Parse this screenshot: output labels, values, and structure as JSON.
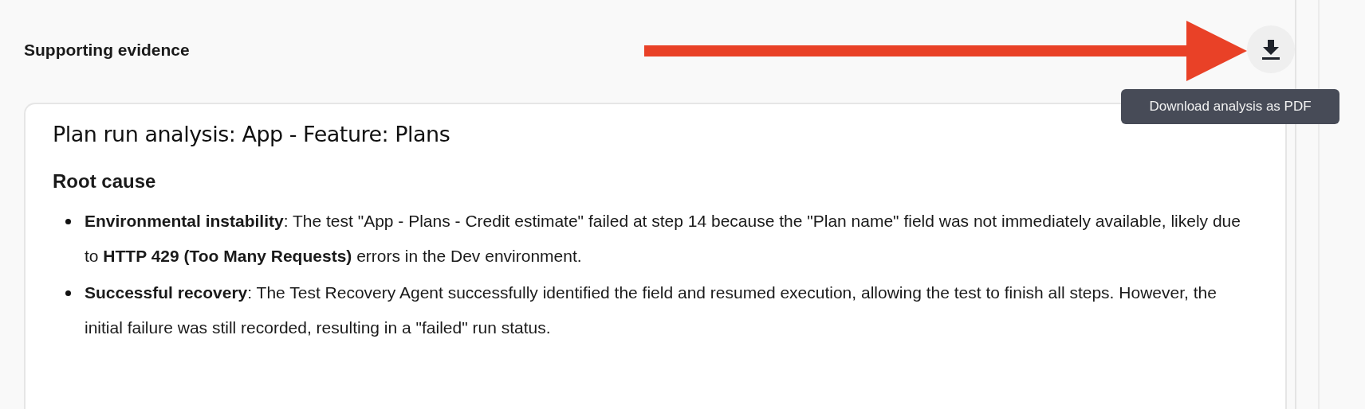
{
  "section": {
    "title": "Supporting evidence"
  },
  "download_button": {
    "tooltip": "Download analysis as PDF"
  },
  "card": {
    "title": "Plan run analysis: App - Feature: Plans",
    "subheading": "Root cause",
    "bullets": [
      {
        "text": "**Environmental instability**: The test \"App - Plans - Credit estimate\" failed at step 14 because the \"Plan name\" field was not immediately available, likely due to **HTTP 429 (Too Many Requests)** errors in the Dev environment."
      },
      {
        "text": "**Successful recovery**: The Test Recovery Agent successfully identified the field and resumed execution, allowing the test to finish all steps. However, the initial failure was still recorded, resulting in a \"failed\" run status."
      }
    ]
  }
}
